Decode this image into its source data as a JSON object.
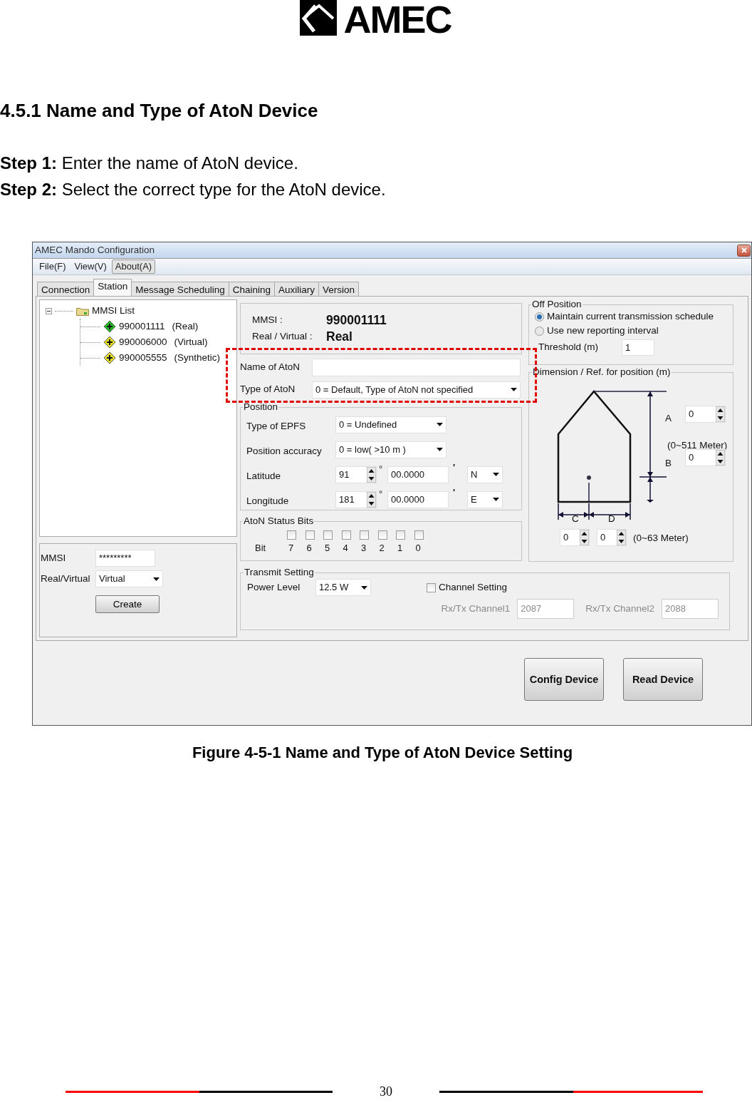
{
  "logo": {
    "text": "AMEC"
  },
  "heading": "4.5.1 Name and Type of AtoN Device",
  "steps": [
    {
      "label": "Step 1:",
      "text": "Enter the name of AtoN device."
    },
    {
      "label": "Step 2:",
      "text": "Select the correct type for the AtoN device."
    }
  ],
  "window": {
    "title": "AMEC Mando Configuration",
    "menu": [
      {
        "label": "File(F)",
        "selected": false
      },
      {
        "label": "View(V)",
        "selected": false
      },
      {
        "label": "About(A)",
        "selected": true
      }
    ],
    "tabs": [
      {
        "label": "Connection",
        "selected": false
      },
      {
        "label": "Station",
        "selected": true
      },
      {
        "label": "Message Scheduling",
        "selected": false
      },
      {
        "label": "Chaining",
        "selected": false
      },
      {
        "label": "Auxiliary",
        "selected": false
      },
      {
        "label": "Version",
        "selected": false
      }
    ],
    "tree": {
      "label": "MMSI List",
      "expanded": true,
      "children": [
        {
          "label": "990001111",
          "note": "(Real)",
          "color": "#22c022"
        },
        {
          "label": "990006000",
          "note": "(Virtual)",
          "color": "#e8e030"
        },
        {
          "label": "990005555",
          "note": "(Synthetic)",
          "color": "#e8e030"
        }
      ]
    },
    "create": {
      "mmsi_label": "MMSI",
      "mmsi": "*********",
      "type_label": "Real/Virtual",
      "type": "Virtual",
      "button": "Create"
    },
    "station": {
      "mmsi_label": "MMSI :",
      "mmsi": "990001111",
      "type_label": "Real / Virtual :",
      "type": "Real"
    },
    "name_field": {
      "label": "Name of AtoN"
    },
    "type_field": {
      "label": "Type of AtoN",
      "value": "0 = Default, Type of AtoN not specified"
    },
    "position": {
      "title": "Position",
      "epfs": {
        "label": "Type of EPFS",
        "value": "0 = Undefined"
      },
      "accuracy": {
        "label": "Position accuracy",
        "value": "0 = low( >10 m )"
      },
      "coords": [
        {
          "label": "Latitude",
          "degrees": "91",
          "degree_mark": "°",
          "minutes": "00.0000",
          "minute_mark": "'",
          "hemisphere": "N"
        },
        {
          "label": "Longitude",
          "degrees": "181",
          "degree_mark": "°",
          "minutes": "00.0000",
          "minute_mark": "'",
          "hemisphere": "E"
        }
      ]
    },
    "status_bits": {
      "title": "AtoN Status Bits",
      "label": "Bit",
      "bits": [
        {
          "label": "7",
          "checked": false
        },
        {
          "label": "6",
          "checked": false
        },
        {
          "label": "5",
          "checked": false
        },
        {
          "label": "4",
          "checked": false
        },
        {
          "label": "3",
          "checked": false
        },
        {
          "label": "2",
          "checked": false
        },
        {
          "label": "1",
          "checked": false
        },
        {
          "label": "0",
          "checked": false
        }
      ]
    },
    "off_position": {
      "title": "Off Position",
      "options": [
        {
          "label": "Maintain current transmission schedule",
          "selected": true
        },
        {
          "label": "Use new reporting interval",
          "selected": false
        }
      ],
      "threshold_label": "Threshold (m)",
      "threshold": "1"
    },
    "dimension": {
      "title": "Dimension / Ref. for position (m)",
      "a_label": "A",
      "a": "0",
      "ab_range": "(0~511 Meter)",
      "b_label": "B",
      "b": "0",
      "c_label": "C",
      "d_label": "D",
      "c": "0",
      "d": "0",
      "cd_range": "(0~63 Meter)"
    },
    "transmit": {
      "title": "Transmit Setting",
      "power_label": "Power Level",
      "power": "12.5 W",
      "channel_setting": {
        "label": "Channel Setting",
        "checked": false
      },
      "channels": [
        {
          "label": "Rx/Tx Channel1",
          "value": "2087",
          "disabled": true
        },
        {
          "label": "Rx/Tx Channel2",
          "value": "2088",
          "disabled": true
        }
      ]
    },
    "actions": [
      "Config Device",
      "Read Device"
    ]
  },
  "caption": "Figure 4-5-1 Name and Type of AtoN Device Setting",
  "page_number": "30"
}
